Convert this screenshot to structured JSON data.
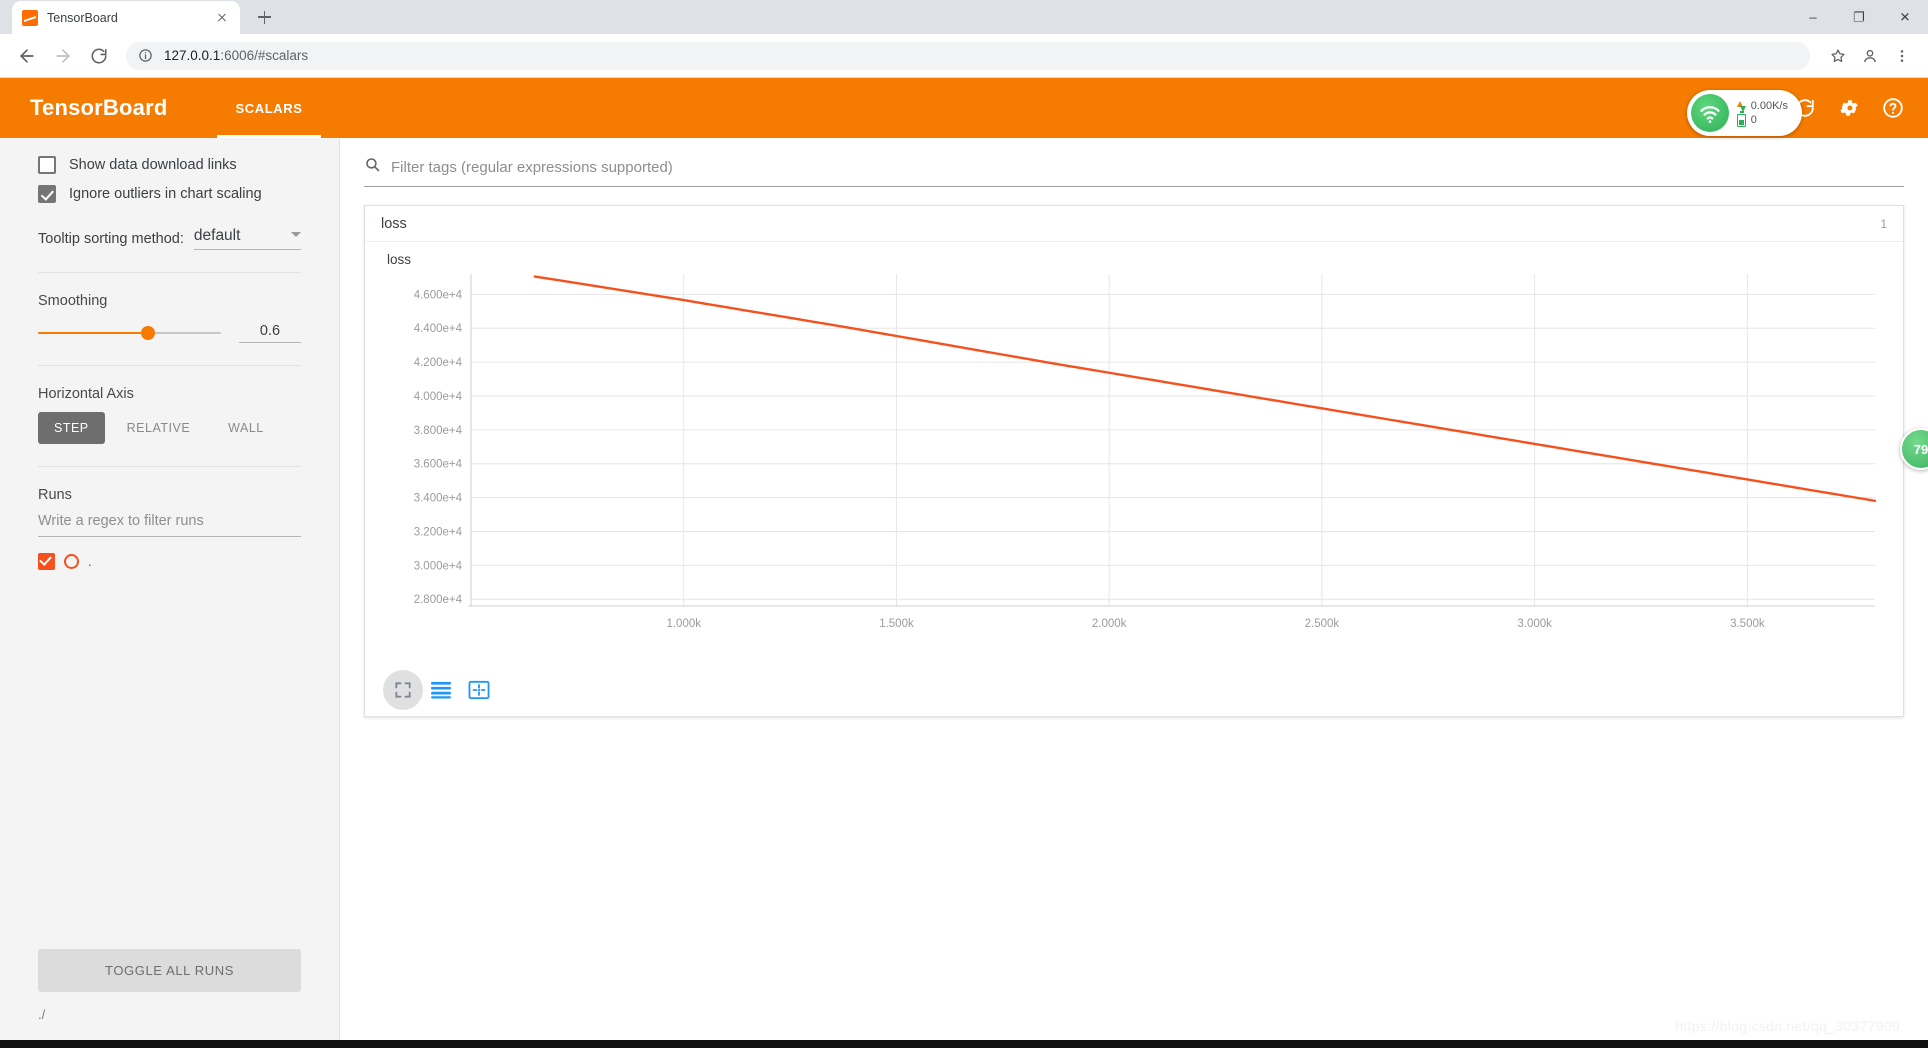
{
  "browser": {
    "tab_title": "TensorBoard",
    "favicon_name": "tensorboard-favicon",
    "new_tab_label": "+",
    "url_host": "127.0.0.1",
    "url_rest": ":6006/#scalars",
    "window_minimize": "–",
    "window_maximize": "❐",
    "window_close": "✕"
  },
  "tensorboard": {
    "logo": "TensorBoard",
    "tabs": [
      {
        "label": "SCALARS",
        "active": true
      }
    ],
    "net_widget": {
      "speed": "0.00K/s",
      "battery": "0"
    },
    "side_badge": "79"
  },
  "sidebar": {
    "show_download_links": {
      "label": "Show data download links",
      "checked": false
    },
    "ignore_outliers": {
      "label": "Ignore outliers in chart scaling",
      "checked": true
    },
    "tooltip_sorting": {
      "label": "Tooltip sorting method:",
      "value": "default"
    },
    "smoothing": {
      "title": "Smoothing",
      "value": "0.6",
      "percent": 60
    },
    "horizontal_axis": {
      "title": "Horizontal Axis",
      "options": [
        {
          "label": "STEP",
          "active": true
        },
        {
          "label": "RELATIVE",
          "active": false
        },
        {
          "label": "WALL",
          "active": false
        }
      ]
    },
    "runs": {
      "title": "Runs",
      "filter_placeholder": "Write a regex to filter runs",
      "items": [
        {
          "name": ".",
          "checked": true,
          "color": "#f4511e"
        }
      ],
      "toggle_all_label": "TOGGLE ALL RUNS",
      "path_label": "./"
    }
  },
  "main": {
    "filter_placeholder": "Filter tags (regular expressions supported)",
    "card": {
      "title": "loss",
      "count": "1"
    },
    "chart_tools": [
      {
        "name": "expand-chart-icon",
        "active": true
      },
      {
        "name": "data-table-icon",
        "active": false
      },
      {
        "name": "fit-domain-icon",
        "active": false
      }
    ]
  },
  "watermark": "https://blog.csdn.net/qq_30377909",
  "colors": {
    "brand_orange": "#f57c00",
    "series_orange": "#f4511e",
    "tool_blue": "#2196f3"
  },
  "chart_data": {
    "type": "line",
    "title": "loss",
    "xlabel": "",
    "ylabel": "",
    "grid": true,
    "legend": "none",
    "xlim": [
      500,
      3800
    ],
    "ylim": [
      27600,
      47200
    ],
    "xticks": [
      1000,
      1500,
      2000,
      2500,
      3000,
      3500
    ],
    "xticklabels": [
      "1.000k",
      "1.500k",
      "2.000k",
      "2.500k",
      "3.000k",
      "3.500k"
    ],
    "yticks": [
      28000,
      30000,
      32000,
      34000,
      36000,
      38000,
      40000,
      42000,
      44000,
      46000
    ],
    "yticklabels": [
      "2.800e+4",
      "3.000e+4",
      "3.200e+4",
      "3.400e+4",
      "3.600e+4",
      "3.800e+4",
      "4.000e+4",
      "4.200e+4",
      "4.400e+4",
      "4.600e+4"
    ],
    "series": [
      {
        "name": ".",
        "color": "#f4511e",
        "x": [
          650,
          700,
          750,
          800,
          850,
          900,
          950,
          1000,
          1050,
          1100,
          1150,
          1200,
          1250,
          1300,
          1350,
          1400,
          1450,
          1500,
          1550,
          1600,
          1650,
          1700,
          1750,
          1800,
          1850,
          1900,
          1950,
          2000,
          2050,
          2100,
          2150,
          2200,
          2250,
          2300,
          2350,
          2400,
          2450,
          2500,
          2550,
          2600,
          2650,
          2700,
          2750,
          2800,
          2850,
          2900,
          2950,
          3000,
          3050,
          3100,
          3150,
          3200,
          3250,
          3300,
          3350,
          3400,
          3450,
          3500,
          3550,
          3600,
          3650,
          3700,
          3750,
          3800
        ],
        "y": [
          47050,
          46860,
          46660,
          46460,
          46260,
          46060,
          45860,
          45660,
          45450,
          45240,
          45030,
          44820,
          44610,
          44400,
          44190,
          43980,
          43760,
          43540,
          43320,
          43100,
          42880,
          42660,
          42440,
          42220,
          42000,
          41790,
          41580,
          41370,
          41160,
          40950,
          40740,
          40530,
          40320,
          40110,
          39900,
          39690,
          39480,
          39270,
          39060,
          38850,
          38640,
          38430,
          38220,
          38010,
          37800,
          37590,
          37380,
          37170,
          36960,
          36750,
          36540,
          36330,
          36120,
          35910,
          35700,
          35490,
          35280,
          35070,
          34860,
          34650,
          34440,
          34230,
          34020,
          33810
        ]
      }
    ]
  }
}
